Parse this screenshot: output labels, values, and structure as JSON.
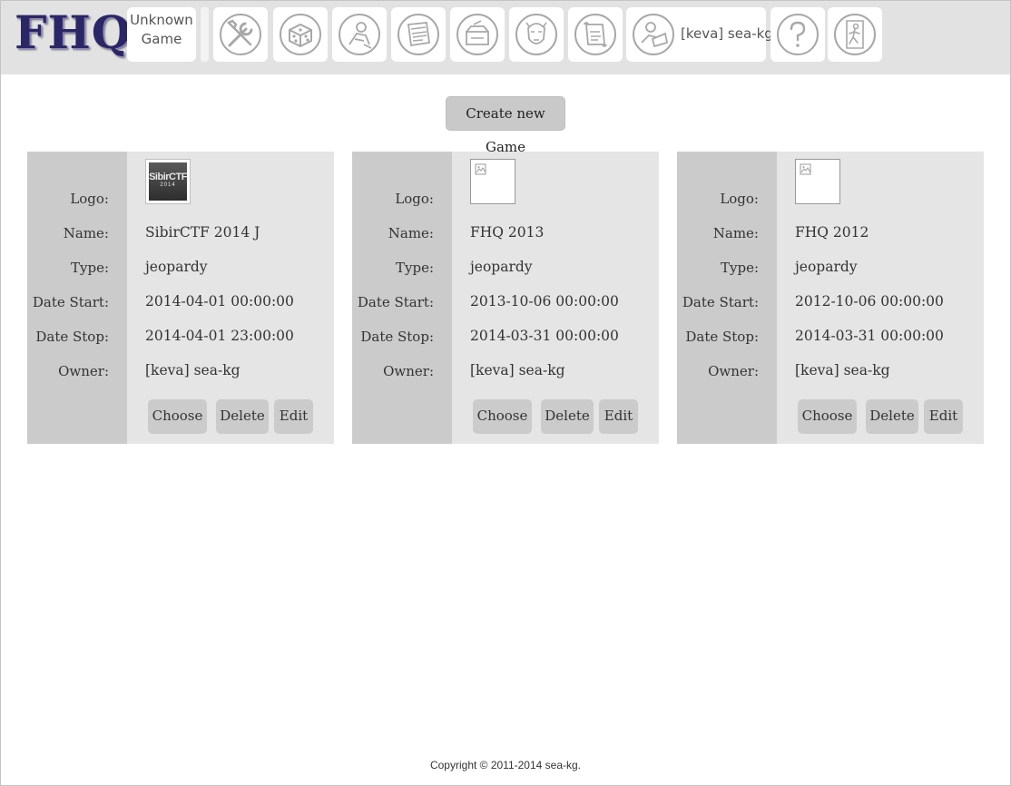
{
  "header": {
    "logo_text": "FHQ",
    "game_line1": "Unknown",
    "game_line2": "Game",
    "nav": [
      {
        "icon": "tools-icon",
        "label": ""
      },
      {
        "icon": "dice-icon",
        "label": ""
      },
      {
        "icon": "thinker-icon",
        "label": ""
      },
      {
        "icon": "news-icon",
        "label": ""
      },
      {
        "icon": "feedback-icon",
        "label": ""
      },
      {
        "icon": "hacker-face-icon",
        "label": ""
      },
      {
        "icon": "rules-scroll-icon",
        "label": ""
      },
      {
        "icon": "user-at-laptop-icon",
        "label": "[keva] sea-kg"
      },
      {
        "icon": "help-question-icon",
        "label": ""
      },
      {
        "icon": "exit-running-man-icon",
        "label": ""
      }
    ]
  },
  "toolbar": {
    "create_label": "Create new Game"
  },
  "labels": {
    "logo": "Logo:",
    "name": "Name:",
    "type": "Type:",
    "date_start": "Date Start:",
    "date_stop": "Date Stop:",
    "owner": "Owner:"
  },
  "buttons": {
    "choose": "Choose",
    "delete": "Delete",
    "edit": "Edit"
  },
  "games": [
    {
      "logo": "SibirCTF",
      "logo_sub": "2014",
      "name": "SibirCTF 2014 J",
      "type": "jeopardy",
      "date_start": "2014-04-01 00:00:00",
      "date_stop": "2014-04-01 23:00:00",
      "owner": "[keva] sea-kg"
    },
    {
      "logo": "",
      "name": "FHQ 2013",
      "type": "jeopardy",
      "date_start": "2013-10-06 00:00:00",
      "date_stop": "2014-03-31 00:00:00",
      "owner": "[keva] sea-kg"
    },
    {
      "logo": "",
      "name": "FHQ 2012",
      "type": "jeopardy",
      "date_start": "2012-10-06 00:00:00",
      "date_stop": "2014-03-31 00:00:00",
      "owner": "[keva] sea-kg"
    }
  ],
  "footer": {
    "copyright": "Copyright © 2011-2014 sea-kg."
  }
}
